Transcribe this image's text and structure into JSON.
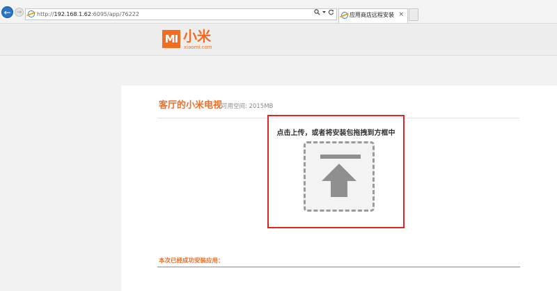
{
  "browser": {
    "url_prefix": "http://",
    "url_host": "192.168.1.62",
    "url_rest": ":6095/app/76222",
    "search_icon": "search-icon",
    "refresh_icon": "refresh-icon",
    "tab_title": "应用商店远程安装",
    "tab_close": "×",
    "back_glyph": "←",
    "forward_glyph": "→"
  },
  "brand": {
    "logo_text": "MI",
    "name": "小米",
    "domain": "xiaomi.com",
    "color": "#f26c22"
  },
  "device": {
    "title": "客厅的小米电视",
    "space_label": "可用空间: 2015MB"
  },
  "upload": {
    "hint": "点击上传，或者将安装包拖拽到方框中",
    "icon": "upload-arrow-icon",
    "frame_color": "#e02424"
  },
  "installed": {
    "label": "本次已经成功安装应用："
  }
}
